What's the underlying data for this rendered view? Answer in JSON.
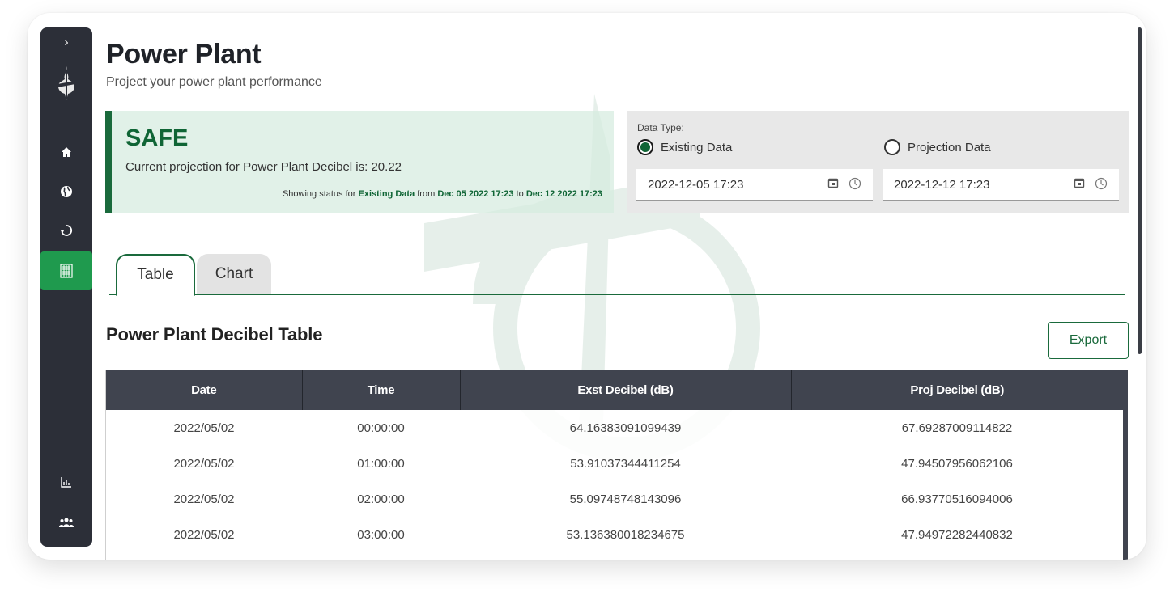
{
  "header": {
    "title": "Power Plant",
    "subtitle": "Project your power plant performance"
  },
  "status": {
    "level": "SAFE",
    "message": "Current projection for Power Plant Decibel is: 20.22",
    "foot_prefix": "Showing status for",
    "foot_type": "Existing Data",
    "foot_from_word": "from",
    "foot_from": "Dec 05 2022 17:23",
    "foot_to_word": "to",
    "foot_to": "Dec 12 2022 17:23"
  },
  "data_type": {
    "label": "Data Type:",
    "options": [
      {
        "label": "Existing Data",
        "selected": true
      },
      {
        "label": "Projection Data",
        "selected": false
      }
    ],
    "start_datetime": "2022-12-05 17:23",
    "end_datetime": "2022-12-12 17:23"
  },
  "tabs": [
    {
      "label": "Table",
      "active": true
    },
    {
      "label": "Chart",
      "active": false
    }
  ],
  "table_section": {
    "title": "Power Plant Decibel Table",
    "export_label": "Export",
    "columns": [
      "Date",
      "Time",
      "Exst Decibel (dB)",
      "Proj Decibel (dB)"
    ],
    "rows": [
      [
        "2022/05/02",
        "00:00:00",
        "64.16383091099439",
        "67.69287009114822"
      ],
      [
        "2022/05/02",
        "01:00:00",
        "53.91037344411254",
        "47.94507956062106"
      ],
      [
        "2022/05/02",
        "02:00:00",
        "55.09748748143096",
        "66.93770516094006"
      ],
      [
        "2022/05/02",
        "03:00:00",
        "53.136380018234675",
        "47.94972282440832"
      ]
    ]
  },
  "sidebar": {
    "expand_icon": "chevron-right-icon",
    "items": [
      {
        "icon": "home-icon",
        "active": false
      },
      {
        "icon": "globe-icon",
        "active": false
      },
      {
        "icon": "recycle-icon",
        "active": false
      },
      {
        "icon": "power-plant-icon",
        "active": true
      },
      {
        "icon": "chart-icon",
        "active": false
      },
      {
        "icon": "users-icon",
        "active": false
      }
    ]
  },
  "colors": {
    "brand_green": "#1a6a3c",
    "active_green": "#1f9a4e",
    "sidebar_bg": "#2c2f38",
    "table_header_bg": "#40444f"
  }
}
